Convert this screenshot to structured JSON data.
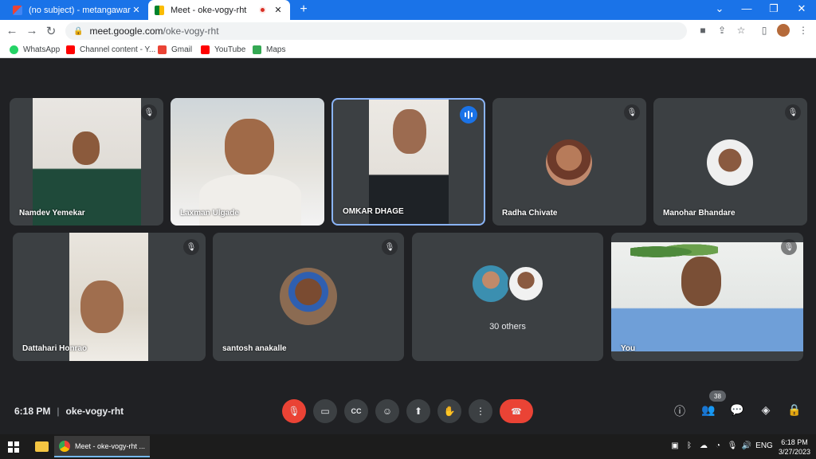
{
  "browser": {
    "tabs": [
      {
        "title": "(no subject) - metangawar@gma",
        "close": "✕"
      },
      {
        "title": "Meet - oke-vogy-rht",
        "close": "✕"
      }
    ],
    "new_tab": "+",
    "window_controls": [
      "⌄",
      "—",
      "❐",
      "✕"
    ],
    "url_host": "meet.google.com",
    "url_path": "/oke-vogy-rht",
    "bookmarks": [
      {
        "label": "WhatsApp",
        "color": "#25d366"
      },
      {
        "label": "Channel content - Y...",
        "color": "#ff0000"
      },
      {
        "label": "Gmail",
        "color": "#ea4335"
      },
      {
        "label": "YouTube",
        "color": "#ff0000"
      },
      {
        "label": "Maps",
        "color": "#34a853"
      }
    ]
  },
  "participants": [
    {
      "name": "Namdev Yemekar",
      "muted": true
    },
    {
      "name": "Laxman Ulgade",
      "muted": false
    },
    {
      "name": "OMKAR DHAGE",
      "muted": false,
      "speaking": true
    },
    {
      "name": "Radha Chivate",
      "muted": true
    },
    {
      "name": "Manohar Bhandare",
      "muted": true
    },
    {
      "name": "Dattahari Honrao",
      "muted": true
    },
    {
      "name": "santosh anakalle",
      "muted": true
    },
    {
      "name": "",
      "others_label": "30 others"
    },
    {
      "name": "You",
      "muted": true
    }
  ],
  "meeting": {
    "time": "6:18 PM",
    "separator": "|",
    "code": "oke-vogy-rht",
    "people_count": "38"
  },
  "controls": {
    "leave_color": "#ea4335",
    "mic_muted_color": "#ea4335"
  },
  "taskbar": {
    "chrome_label": "Meet - oke-vogy-rht ...",
    "language": "ENG",
    "time": "6:18 PM",
    "date": "3/27/2023"
  }
}
